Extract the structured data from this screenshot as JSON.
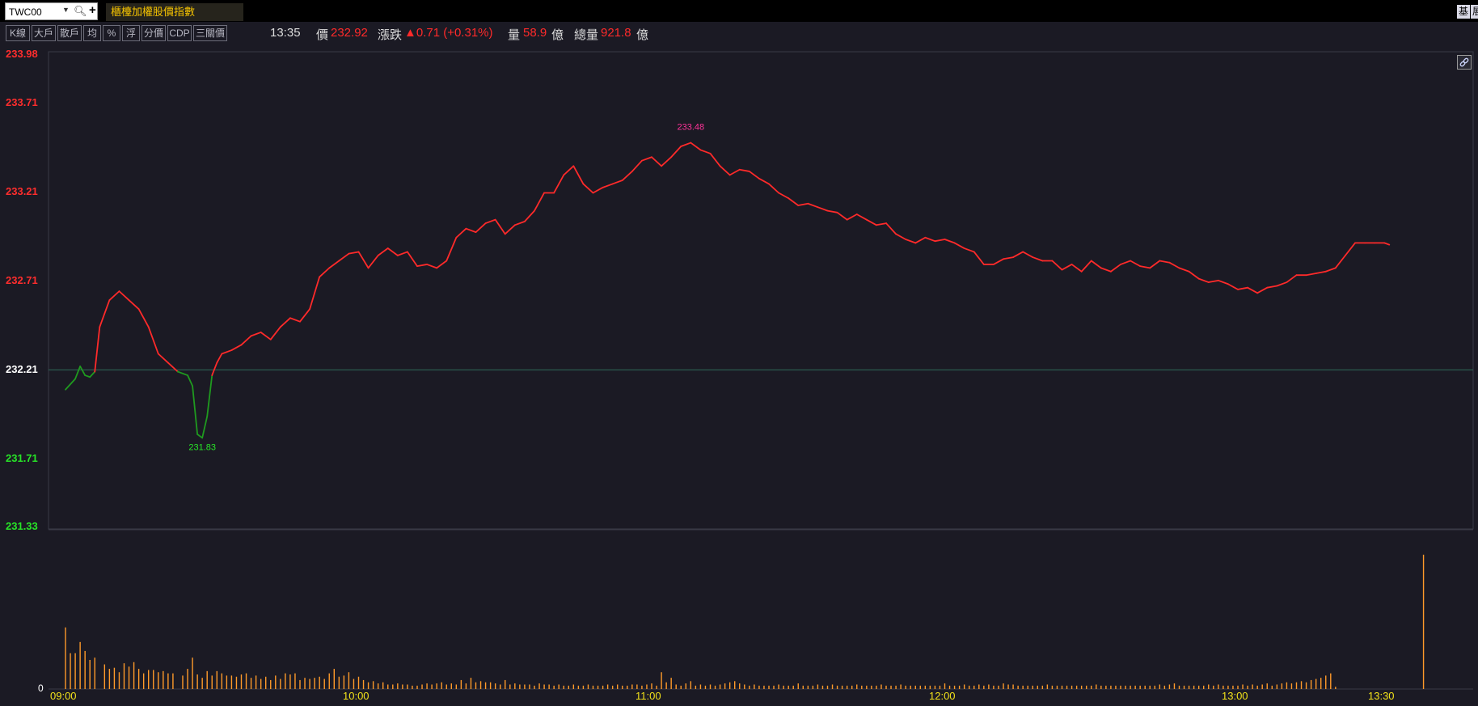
{
  "header": {
    "symbol": "TWC00",
    "index_name": "櫃檯加權股價指數",
    "right_buttons": [
      "基",
      "展"
    ]
  },
  "toolbar": {
    "buttons": [
      "K線",
      "大戶",
      "散戶",
      "均",
      "%",
      "浮",
      "分價",
      "CDP",
      "三關價"
    ]
  },
  "quote": {
    "time": "13:35",
    "price_label": "價",
    "price": "232.92",
    "change_label": "漲跌",
    "change": "▲0.71 (+0.31%)",
    "volume_label": "量",
    "volume": "58.9",
    "volume_unit": "億",
    "total_volume_label": "總量",
    "total_volume": "921.8",
    "total_volume_unit": "億"
  },
  "colors": {
    "up": "#ff2a2a",
    "down": "#1f9a1f",
    "volume": "#ff9a2a",
    "reference_line": "#2f6a5a",
    "background": "#1b1a24",
    "time_labels": "#f2e21a"
  },
  "icons": [
    "search-icon",
    "add-icon",
    "dropdown-arrow-icon",
    "link-icon"
  ],
  "chart_data": {
    "type": "line",
    "reference_price": 232.21,
    "high_label": "233.48",
    "low_label": "231.83",
    "y_ticks": [
      {
        "label": "233.98",
        "value": 233.98,
        "kind": "up"
      },
      {
        "label": "233.71",
        "value": 233.71,
        "kind": "up"
      },
      {
        "label": "233.21",
        "value": 233.21,
        "kind": "up"
      },
      {
        "label": "232.71",
        "value": 232.71,
        "kind": "up"
      },
      {
        "label": "232.21",
        "value": 232.21,
        "kind": "ref"
      },
      {
        "label": "231.71",
        "value": 231.71,
        "kind": "down"
      },
      {
        "label": "231.33",
        "value": 231.33,
        "kind": "down"
      }
    ],
    "ylim": [
      231.33,
      233.98
    ],
    "x_ticks": [
      "09:00",
      "10:00",
      "11:00",
      "12:00",
      "13:00",
      "13:30"
    ],
    "x_tick_minutes": [
      0,
      60,
      120,
      180,
      240,
      270
    ],
    "volume_axis_label": "0",
    "price_series": [
      [
        0,
        232.1
      ],
      [
        2,
        232.16
      ],
      [
        3,
        232.23
      ],
      [
        4,
        232.18
      ],
      [
        5,
        232.17
      ],
      [
        6,
        232.2
      ],
      [
        7,
        232.45
      ],
      [
        9,
        232.6
      ],
      [
        11,
        232.65
      ],
      [
        13,
        232.6
      ],
      [
        15,
        232.55
      ],
      [
        17,
        232.45
      ],
      [
        19,
        232.3
      ],
      [
        21,
        232.25
      ],
      [
        23,
        232.2
      ],
      [
        25,
        232.18
      ],
      [
        26,
        232.12
      ],
      [
        27,
        231.85
      ],
      [
        28,
        231.83
      ],
      [
        29,
        231.95
      ],
      [
        30,
        232.18
      ],
      [
        31,
        232.25
      ],
      [
        32,
        232.3
      ],
      [
        34,
        232.32
      ],
      [
        36,
        232.35
      ],
      [
        38,
        232.4
      ],
      [
        40,
        232.42
      ],
      [
        42,
        232.38
      ],
      [
        44,
        232.45
      ],
      [
        46,
        232.5
      ],
      [
        48,
        232.48
      ],
      [
        50,
        232.55
      ],
      [
        52,
        232.73
      ],
      [
        54,
        232.78
      ],
      [
        56,
        232.82
      ],
      [
        58,
        232.86
      ],
      [
        60,
        232.87
      ],
      [
        62,
        232.78
      ],
      [
        64,
        232.85
      ],
      [
        66,
        232.89
      ],
      [
        68,
        232.85
      ],
      [
        70,
        232.87
      ],
      [
        72,
        232.79
      ],
      [
        74,
        232.8
      ],
      [
        76,
        232.78
      ],
      [
        78,
        232.82
      ],
      [
        80,
        232.95
      ],
      [
        82,
        233.0
      ],
      [
        84,
        232.98
      ],
      [
        86,
        233.03
      ],
      [
        88,
        233.05
      ],
      [
        90,
        232.97
      ],
      [
        92,
        233.02
      ],
      [
        94,
        233.04
      ],
      [
        96,
        233.1
      ],
      [
        98,
        233.2
      ],
      [
        100,
        233.2
      ],
      [
        102,
        233.3
      ],
      [
        104,
        233.35
      ],
      [
        106,
        233.25
      ],
      [
        108,
        233.2
      ],
      [
        110,
        233.23
      ],
      [
        112,
        233.25
      ],
      [
        114,
        233.27
      ],
      [
        116,
        233.32
      ],
      [
        118,
        233.38
      ],
      [
        120,
        233.4
      ],
      [
        122,
        233.35
      ],
      [
        124,
        233.4
      ],
      [
        126,
        233.46
      ],
      [
        128,
        233.48
      ],
      [
        130,
        233.44
      ],
      [
        132,
        233.42
      ],
      [
        134,
        233.35
      ],
      [
        136,
        233.3
      ],
      [
        138,
        233.33
      ],
      [
        140,
        233.32
      ],
      [
        142,
        233.28
      ],
      [
        144,
        233.25
      ],
      [
        146,
        233.2
      ],
      [
        148,
        233.17
      ],
      [
        150,
        233.13
      ],
      [
        152,
        233.14
      ],
      [
        154,
        233.12
      ],
      [
        156,
        233.1
      ],
      [
        158,
        233.09
      ],
      [
        160,
        233.05
      ],
      [
        162,
        233.08
      ],
      [
        164,
        233.05
      ],
      [
        166,
        233.02
      ],
      [
        168,
        233.03
      ],
      [
        170,
        232.97
      ],
      [
        172,
        232.94
      ],
      [
        174,
        232.92
      ],
      [
        176,
        232.95
      ],
      [
        178,
        232.93
      ],
      [
        180,
        232.94
      ],
      [
        182,
        232.92
      ],
      [
        184,
        232.89
      ],
      [
        186,
        232.87
      ],
      [
        188,
        232.8
      ],
      [
        190,
        232.8
      ],
      [
        192,
        232.83
      ],
      [
        194,
        232.84
      ],
      [
        196,
        232.87
      ],
      [
        198,
        232.84
      ],
      [
        200,
        232.82
      ],
      [
        202,
        232.82
      ],
      [
        204,
        232.77
      ],
      [
        206,
        232.8
      ],
      [
        208,
        232.76
      ],
      [
        210,
        232.82
      ],
      [
        212,
        232.78
      ],
      [
        214,
        232.76
      ],
      [
        216,
        232.8
      ],
      [
        218,
        232.82
      ],
      [
        220,
        232.79
      ],
      [
        222,
        232.78
      ],
      [
        224,
        232.82
      ],
      [
        226,
        232.81
      ],
      [
        228,
        232.78
      ],
      [
        230,
        232.76
      ],
      [
        232,
        232.72
      ],
      [
        234,
        232.7
      ],
      [
        236,
        232.71
      ],
      [
        238,
        232.69
      ],
      [
        240,
        232.66
      ],
      [
        242,
        232.67
      ],
      [
        244,
        232.64
      ],
      [
        246,
        232.67
      ],
      [
        248,
        232.68
      ],
      [
        250,
        232.7
      ],
      [
        252,
        232.74
      ],
      [
        254,
        232.74
      ],
      [
        256,
        232.75
      ],
      [
        258,
        232.76
      ],
      [
        260,
        232.78
      ],
      [
        262,
        232.85
      ],
      [
        264,
        232.92
      ],
      [
        266,
        232.92
      ],
      [
        268,
        232.92
      ],
      [
        270,
        232.92
      ],
      [
        271,
        232.91
      ]
    ],
    "volume_series": [
      [
        0,
        55
      ],
      [
        1,
        32
      ],
      [
        2,
        32
      ],
      [
        3,
        42
      ],
      [
        4,
        34
      ],
      [
        5,
        26
      ],
      [
        6,
        28
      ],
      [
        8,
        22
      ],
      [
        9,
        18
      ],
      [
        10,
        19
      ],
      [
        11,
        15
      ],
      [
        12,
        23
      ],
      [
        13,
        20
      ],
      [
        14,
        24
      ],
      [
        15,
        18
      ],
      [
        16,
        14
      ],
      [
        17,
        17
      ],
      [
        18,
        17
      ],
      [
        19,
        15
      ],
      [
        20,
        16
      ],
      [
        21,
        14
      ],
      [
        22,
        14
      ],
      [
        24,
        12
      ],
      [
        25,
        18
      ],
      [
        26,
        28
      ],
      [
        27,
        13
      ],
      [
        28,
        10
      ],
      [
        29,
        16
      ],
      [
        30,
        12
      ],
      [
        31,
        16
      ],
      [
        32,
        14
      ],
      [
        33,
        12
      ],
      [
        34,
        12
      ],
      [
        35,
        11
      ],
      [
        36,
        13
      ],
      [
        37,
        14
      ],
      [
        38,
        10
      ],
      [
        39,
        12
      ],
      [
        40,
        9
      ],
      [
        41,
        11
      ],
      [
        42,
        8
      ],
      [
        43,
        12
      ],
      [
        44,
        9
      ],
      [
        45,
        14
      ],
      [
        46,
        13
      ],
      [
        47,
        14
      ],
      [
        48,
        8
      ],
      [
        49,
        10
      ],
      [
        50,
        9
      ],
      [
        51,
        10
      ],
      [
        52,
        11
      ],
      [
        53,
        9
      ],
      [
        54,
        14
      ],
      [
        55,
        18
      ],
      [
        56,
        11
      ],
      [
        57,
        12
      ],
      [
        58,
        15
      ],
      [
        59,
        9
      ],
      [
        60,
        11
      ],
      [
        61,
        8
      ],
      [
        62,
        6
      ],
      [
        63,
        7
      ],
      [
        64,
        5
      ],
      [
        65,
        6
      ],
      [
        66,
        4
      ],
      [
        67,
        4
      ],
      [
        68,
        5
      ],
      [
        69,
        4
      ],
      [
        70,
        4
      ],
      [
        71,
        3
      ],
      [
        72,
        3
      ],
      [
        73,
        4
      ],
      [
        74,
        5
      ],
      [
        75,
        4
      ],
      [
        76,
        5
      ],
      [
        77,
        6
      ],
      [
        78,
        4
      ],
      [
        79,
        5
      ],
      [
        80,
        4
      ],
      [
        81,
        8
      ],
      [
        82,
        5
      ],
      [
        83,
        10
      ],
      [
        84,
        6
      ],
      [
        85,
        7
      ],
      [
        86,
        6
      ],
      [
        87,
        6
      ],
      [
        88,
        5
      ],
      [
        89,
        4
      ],
      [
        90,
        8
      ],
      [
        91,
        4
      ],
      [
        92,
        5
      ],
      [
        93,
        4
      ],
      [
        94,
        4
      ],
      [
        95,
        4
      ],
      [
        96,
        3
      ],
      [
        97,
        5
      ],
      [
        98,
        4
      ],
      [
        99,
        4
      ],
      [
        100,
        3
      ],
      [
        101,
        4
      ],
      [
        102,
        3
      ],
      [
        103,
        3
      ],
      [
        104,
        4
      ],
      [
        105,
        3
      ],
      [
        106,
        3
      ],
      [
        107,
        4
      ],
      [
        108,
        3
      ],
      [
        109,
        3
      ],
      [
        110,
        3
      ],
      [
        111,
        4
      ],
      [
        112,
        3
      ],
      [
        113,
        4
      ],
      [
        114,
        3
      ],
      [
        115,
        3
      ],
      [
        116,
        4
      ],
      [
        117,
        4
      ],
      [
        118,
        3
      ],
      [
        119,
        4
      ],
      [
        120,
        5
      ],
      [
        121,
        3
      ],
      [
        122,
        15
      ],
      [
        123,
        6
      ],
      [
        124,
        10
      ],
      [
        125,
        4
      ],
      [
        126,
        3
      ],
      [
        127,
        5
      ],
      [
        128,
        7
      ],
      [
        129,
        3
      ],
      [
        130,
        4
      ],
      [
        131,
        3
      ],
      [
        132,
        4
      ],
      [
        133,
        3
      ],
      [
        134,
        4
      ],
      [
        135,
        5
      ],
      [
        136,
        6
      ],
      [
        137,
        7
      ],
      [
        138,
        5
      ],
      [
        139,
        4
      ],
      [
        140,
        3
      ],
      [
        141,
        4
      ],
      [
        142,
        3
      ],
      [
        143,
        3
      ],
      [
        144,
        3
      ],
      [
        145,
        3
      ],
      [
        146,
        4
      ],
      [
        147,
        3
      ],
      [
        148,
        3
      ],
      [
        149,
        3
      ],
      [
        150,
        5
      ],
      [
        151,
        3
      ],
      [
        152,
        3
      ],
      [
        153,
        3
      ],
      [
        154,
        4
      ],
      [
        155,
        3
      ],
      [
        156,
        3
      ],
      [
        157,
        4
      ],
      [
        158,
        3
      ],
      [
        159,
        3
      ],
      [
        160,
        3
      ],
      [
        161,
        3
      ],
      [
        162,
        4
      ],
      [
        163,
        3
      ],
      [
        164,
        3
      ],
      [
        165,
        3
      ],
      [
        166,
        3
      ],
      [
        167,
        4
      ],
      [
        168,
        3
      ],
      [
        169,
        3
      ],
      [
        170,
        3
      ],
      [
        171,
        4
      ],
      [
        172,
        3
      ],
      [
        173,
        3
      ],
      [
        174,
        3
      ],
      [
        175,
        3
      ],
      [
        176,
        3
      ],
      [
        177,
        3
      ],
      [
        178,
        3
      ],
      [
        179,
        3
      ],
      [
        180,
        5
      ],
      [
        181,
        3
      ],
      [
        182,
        3
      ],
      [
        183,
        3
      ],
      [
        184,
        4
      ],
      [
        185,
        3
      ],
      [
        186,
        3
      ],
      [
        187,
        4
      ],
      [
        188,
        3
      ],
      [
        189,
        4
      ],
      [
        190,
        3
      ],
      [
        191,
        3
      ],
      [
        192,
        5
      ],
      [
        193,
        4
      ],
      [
        194,
        4
      ],
      [
        195,
        3
      ],
      [
        196,
        3
      ],
      [
        197,
        3
      ],
      [
        198,
        3
      ],
      [
        199,
        3
      ],
      [
        200,
        3
      ],
      [
        201,
        4
      ],
      [
        202,
        3
      ],
      [
        203,
        3
      ],
      [
        204,
        3
      ],
      [
        205,
        3
      ],
      [
        206,
        3
      ],
      [
        207,
        3
      ],
      [
        208,
        3
      ],
      [
        209,
        3
      ],
      [
        210,
        3
      ],
      [
        211,
        4
      ],
      [
        212,
        3
      ],
      [
        213,
        3
      ],
      [
        214,
        3
      ],
      [
        215,
        3
      ],
      [
        216,
        3
      ],
      [
        217,
        3
      ],
      [
        218,
        3
      ],
      [
        219,
        3
      ],
      [
        220,
        3
      ],
      [
        221,
        3
      ],
      [
        222,
        3
      ],
      [
        223,
        3
      ],
      [
        224,
        4
      ],
      [
        225,
        3
      ],
      [
        226,
        4
      ],
      [
        227,
        5
      ],
      [
        228,
        3
      ],
      [
        229,
        3
      ],
      [
        230,
        3
      ],
      [
        231,
        3
      ],
      [
        232,
        3
      ],
      [
        233,
        3
      ],
      [
        234,
        4
      ],
      [
        235,
        3
      ],
      [
        236,
        4
      ],
      [
        237,
        3
      ],
      [
        238,
        3
      ],
      [
        239,
        3
      ],
      [
        240,
        3
      ],
      [
        241,
        4
      ],
      [
        242,
        3
      ],
      [
        243,
        4
      ],
      [
        244,
        3
      ],
      [
        245,
        4
      ],
      [
        246,
        5
      ],
      [
        247,
        3
      ],
      [
        248,
        4
      ],
      [
        249,
        5
      ],
      [
        250,
        6
      ],
      [
        251,
        5
      ],
      [
        252,
        6
      ],
      [
        253,
        7
      ],
      [
        254,
        6
      ],
      [
        255,
        8
      ],
      [
        256,
        9
      ],
      [
        257,
        10
      ],
      [
        258,
        12
      ],
      [
        259,
        14
      ],
      [
        260,
        2
      ],
      [
        278,
        120
      ]
    ],
    "volume_max": 130
  }
}
